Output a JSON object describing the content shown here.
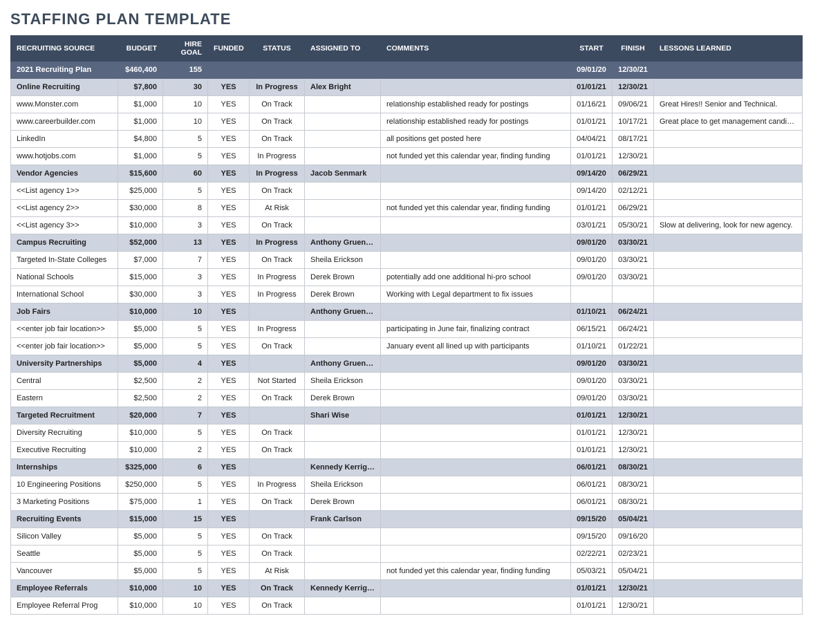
{
  "title": "STAFFING PLAN TEMPLATE",
  "headers": {
    "source": "RECRUITING SOURCE",
    "budget": "BUDGET",
    "hire": "HIRE GOAL",
    "funded": "FUNDED",
    "status": "STATUS",
    "assigned": "ASSIGNED TO",
    "comments": "COMMENTS",
    "start": "START",
    "finish": "FINISH",
    "lessons": "LESSONS LEARNED"
  },
  "rows": [
    {
      "type": "plan",
      "source": "2021 Recruiting Plan",
      "budget": "$460,400",
      "hire": "155",
      "funded": "",
      "status": "",
      "assigned": "",
      "comments": "",
      "start": "09/01/20",
      "finish": "12/30/21",
      "lessons": ""
    },
    {
      "type": "section",
      "source": "Online Recruiting",
      "budget": "$7,800",
      "hire": "30",
      "funded": "YES",
      "status": "In Progress",
      "assigned": "Alex Bright",
      "comments": "",
      "start": "01/01/21",
      "finish": "12/30/21",
      "lessons": ""
    },
    {
      "type": "row",
      "source": "www.Monster.com",
      "budget": "$1,000",
      "hire": "10",
      "funded": "YES",
      "status": "On Track",
      "assigned": "",
      "comments": "relationship established ready for postings",
      "start": "01/16/21",
      "finish": "09/06/21",
      "lessons": "Great Hires!! Senior and Technical."
    },
    {
      "type": "row",
      "source": "www.careerbuilder.com",
      "budget": "$1,000",
      "hire": "10",
      "funded": "YES",
      "status": "On Track",
      "assigned": "",
      "comments": "relationship established ready for postings",
      "start": "01/01/21",
      "finish": "10/17/21",
      "lessons": "Great place to get management candidates."
    },
    {
      "type": "row",
      "source": "LinkedIn",
      "budget": "$4,800",
      "hire": "5",
      "funded": "YES",
      "status": "On Track",
      "assigned": "",
      "comments": "all positions get posted here",
      "start": "04/04/21",
      "finish": "08/17/21",
      "lessons": ""
    },
    {
      "type": "row",
      "source": "www.hotjobs.com",
      "budget": "$1,000",
      "hire": "5",
      "funded": "YES",
      "status": "In Progress",
      "assigned": "",
      "comments": "not funded yet this calendar year, finding funding",
      "start": "01/01/21",
      "finish": "12/30/21",
      "lessons": ""
    },
    {
      "type": "section",
      "source": "Vendor Agencies",
      "budget": "$15,600",
      "hire": "60",
      "funded": "YES",
      "status": "In Progress",
      "assigned": "Jacob Senmark",
      "comments": "",
      "start": "09/14/20",
      "finish": "06/29/21",
      "lessons": ""
    },
    {
      "type": "row",
      "source": "<<List agency 1>>",
      "budget": "$25,000",
      "hire": "5",
      "funded": "YES",
      "status": "On Track",
      "assigned": "",
      "comments": "",
      "start": "09/14/20",
      "finish": "02/12/21",
      "lessons": ""
    },
    {
      "type": "row",
      "source": "<<List agency 2>>",
      "budget": "$30,000",
      "hire": "8",
      "funded": "YES",
      "status": "At Risk",
      "assigned": "",
      "comments": "not funded yet this calendar year, finding funding",
      "start": "01/01/21",
      "finish": "06/29/21",
      "lessons": ""
    },
    {
      "type": "row",
      "source": "<<List agency 3>>",
      "budget": "$10,000",
      "hire": "3",
      "funded": "YES",
      "status": "On Track",
      "assigned": "",
      "comments": "",
      "start": "03/01/21",
      "finish": "05/30/21",
      "lessons": "Slow at delivering, look for new agency."
    },
    {
      "type": "section",
      "source": "Campus Recruiting",
      "budget": "$52,000",
      "hire": "13",
      "funded": "YES",
      "status": "In Progress",
      "assigned": "Anthony Gruenelli",
      "comments": "",
      "start": "09/01/20",
      "finish": "03/30/21",
      "lessons": ""
    },
    {
      "type": "row",
      "source": "Targeted In-State Colleges",
      "budget": "$7,000",
      "hire": "7",
      "funded": "YES",
      "status": "On Track",
      "assigned": "Sheila Erickson",
      "comments": "",
      "start": "09/01/20",
      "finish": "03/30/21",
      "lessons": ""
    },
    {
      "type": "row",
      "source": "National Schools",
      "budget": "$15,000",
      "hire": "3",
      "funded": "YES",
      "status": "In Progress",
      "assigned": "Derek Brown",
      "comments": "potentially add one additional hi-pro school",
      "start": "09/01/20",
      "finish": "03/30/21",
      "lessons": ""
    },
    {
      "type": "row",
      "source": "International School",
      "budget": "$30,000",
      "hire": "3",
      "funded": "YES",
      "status": "In Progress",
      "assigned": "Derek Brown",
      "comments": "Working with Legal department to fix issues",
      "start": "",
      "finish": "",
      "lessons": ""
    },
    {
      "type": "section",
      "source": "Job Fairs",
      "budget": "$10,000",
      "hire": "10",
      "funded": "YES",
      "status": "",
      "assigned": "Anthony Gruenelli",
      "comments": "",
      "start": "01/10/21",
      "finish": "06/24/21",
      "lessons": ""
    },
    {
      "type": "row",
      "source": "<<enter job fair location>>",
      "budget": "$5,000",
      "hire": "5",
      "funded": "YES",
      "status": "In Progress",
      "assigned": "",
      "comments": "participating in June fair, finalizing contract",
      "start": "06/15/21",
      "finish": "06/24/21",
      "lessons": ""
    },
    {
      "type": "row",
      "source": "<<enter job fair location>>",
      "budget": "$5,000",
      "hire": "5",
      "funded": "YES",
      "status": "On Track",
      "assigned": "",
      "comments": "January event all lined up with participants",
      "start": "01/10/21",
      "finish": "01/22/21",
      "lessons": ""
    },
    {
      "type": "section",
      "source": "University Partnerships",
      "budget": "$5,000",
      "hire": "4",
      "funded": "YES",
      "status": "",
      "assigned": "Anthony Gruenelli",
      "comments": "",
      "start": "09/01/20",
      "finish": "03/30/21",
      "lessons": ""
    },
    {
      "type": "row",
      "source": "Central",
      "budget": "$2,500",
      "hire": "2",
      "funded": "YES",
      "status": "Not Started",
      "assigned": "Sheila Erickson",
      "comments": "",
      "start": "09/01/20",
      "finish": "03/30/21",
      "lessons": ""
    },
    {
      "type": "row",
      "source": "Eastern",
      "budget": "$2,500",
      "hire": "2",
      "funded": "YES",
      "status": "On Track",
      "assigned": "Derek Brown",
      "comments": "",
      "start": "09/01/20",
      "finish": "03/30/21",
      "lessons": ""
    },
    {
      "type": "section",
      "source": "Targeted Recruitment",
      "budget": "$20,000",
      "hire": "7",
      "funded": "YES",
      "status": "",
      "assigned": "Shari Wise",
      "comments": "",
      "start": "01/01/21",
      "finish": "12/30/21",
      "lessons": ""
    },
    {
      "type": "row",
      "source": "Diversity Recruiting",
      "budget": "$10,000",
      "hire": "5",
      "funded": "YES",
      "status": "On Track",
      "assigned": "",
      "comments": "",
      "start": "01/01/21",
      "finish": "12/30/21",
      "lessons": ""
    },
    {
      "type": "row",
      "source": "Executive Recruiting",
      "budget": "$10,000",
      "hire": "2",
      "funded": "YES",
      "status": "On Track",
      "assigned": "",
      "comments": "",
      "start": "01/01/21",
      "finish": "12/30/21",
      "lessons": ""
    },
    {
      "type": "section",
      "source": "Internships",
      "budget": "$325,000",
      "hire": "6",
      "funded": "YES",
      "status": "",
      "assigned": "Kennedy Kerrigan",
      "comments": "",
      "start": "06/01/21",
      "finish": "08/30/21",
      "lessons": ""
    },
    {
      "type": "row",
      "source": "10 Engineering Positions",
      "budget": "$250,000",
      "hire": "5",
      "funded": "YES",
      "status": "In Progress",
      "assigned": "Sheila Erickson",
      "comments": "",
      "start": "06/01/21",
      "finish": "08/30/21",
      "lessons": ""
    },
    {
      "type": "row",
      "source": "3 Marketing Positions",
      "budget": "$75,000",
      "hire": "1",
      "funded": "YES",
      "status": "On Track",
      "assigned": "Derek Brown",
      "comments": "",
      "start": "06/01/21",
      "finish": "08/30/21",
      "lessons": ""
    },
    {
      "type": "section",
      "source": "Recruiting Events",
      "budget": "$15,000",
      "hire": "15",
      "funded": "YES",
      "status": "",
      "assigned": "Frank Carlson",
      "comments": "",
      "start": "09/15/20",
      "finish": "05/04/21",
      "lessons": ""
    },
    {
      "type": "row",
      "source": "Silicon Valley",
      "budget": "$5,000",
      "hire": "5",
      "funded": "YES",
      "status": "On Track",
      "assigned": "",
      "comments": "",
      "start": "09/15/20",
      "finish": "09/16/20",
      "lessons": ""
    },
    {
      "type": "row",
      "source": "Seattle",
      "budget": "$5,000",
      "hire": "5",
      "funded": "YES",
      "status": "On Track",
      "assigned": "",
      "comments": "",
      "start": "02/22/21",
      "finish": "02/23/21",
      "lessons": ""
    },
    {
      "type": "row",
      "source": "Vancouver",
      "budget": "$5,000",
      "hire": "5",
      "funded": "YES",
      "status": "At Risk",
      "assigned": "",
      "comments": "not funded yet this calendar year, finding funding",
      "start": "05/03/21",
      "finish": "05/04/21",
      "lessons": ""
    },
    {
      "type": "section",
      "source": "Employee Referrals",
      "budget": "$10,000",
      "hire": "10",
      "funded": "YES",
      "status": "On Track",
      "assigned": "Kennedy Kerrigan",
      "comments": "",
      "start": "01/01/21",
      "finish": "12/30/21",
      "lessons": ""
    },
    {
      "type": "row",
      "source": "Employee Referral Prog",
      "budget": "$10,000",
      "hire": "10",
      "funded": "YES",
      "status": "On Track",
      "assigned": "",
      "comments": "",
      "start": "01/01/21",
      "finish": "12/30/21",
      "lessons": ""
    }
  ]
}
